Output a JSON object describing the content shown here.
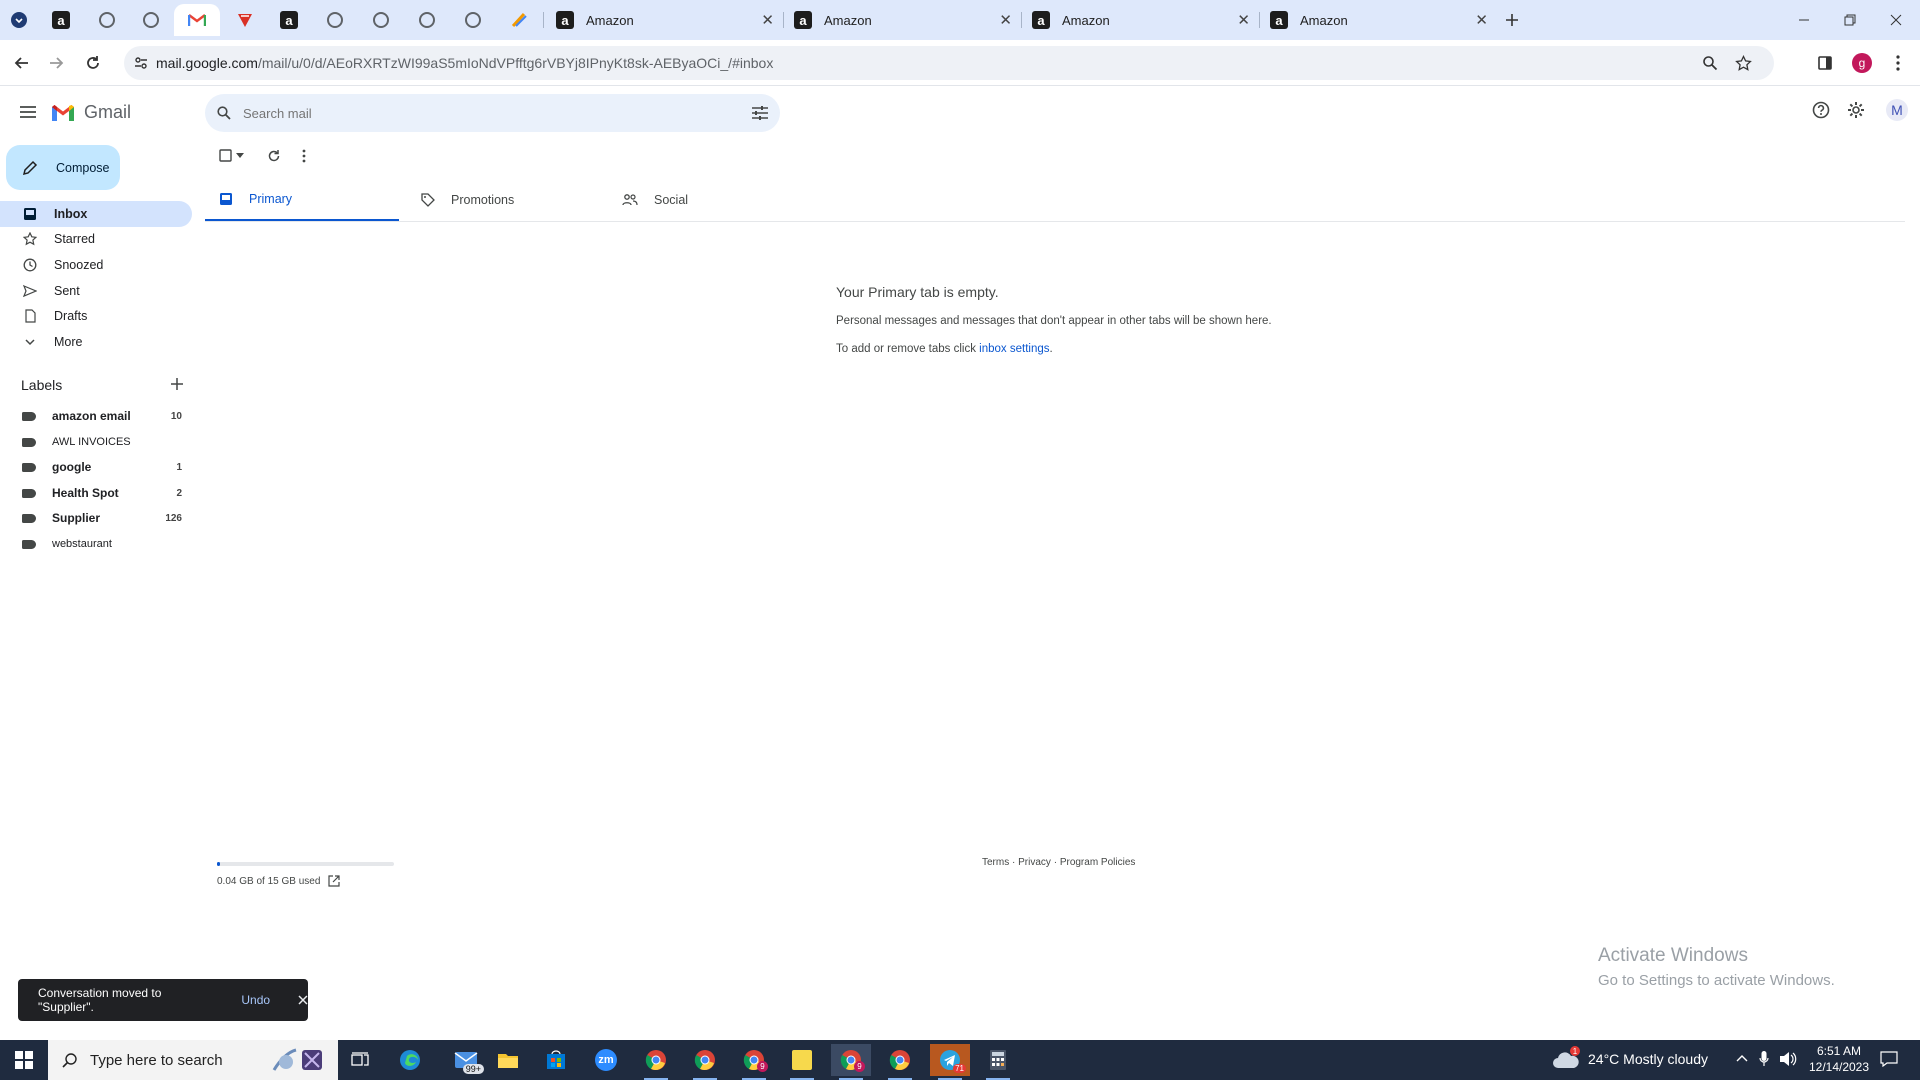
{
  "browser": {
    "tabs": [
      {
        "title": "Amazon"
      },
      {
        "title": "Amazon"
      },
      {
        "title": "Amazon"
      },
      {
        "title": "Amazon"
      }
    ],
    "url_host": "mail.google.com",
    "url_path": "/mail/u/0/d/AEoRXRTzWI99aS5mIoNdVPfftg6rVBYj8IPnyKt8sk-AEByaOCi_/#inbox",
    "profile_initial": "g"
  },
  "gmail": {
    "app_name": "Gmail",
    "search_placeholder": "Search mail",
    "account_initial": "M",
    "compose_label": "Compose",
    "nav": [
      {
        "label": "Inbox"
      },
      {
        "label": "Starred"
      },
      {
        "label": "Snoozed"
      },
      {
        "label": "Sent"
      },
      {
        "label": "Drafts"
      },
      {
        "label": "More"
      }
    ],
    "labels_heading": "Labels",
    "labels": [
      {
        "name": "amazon email",
        "count": "10"
      },
      {
        "name": "AWL INVOICES",
        "count": ""
      },
      {
        "name": "google",
        "count": "1"
      },
      {
        "name": "Health Spot",
        "count": "2"
      },
      {
        "name": "Supplier",
        "count": "126"
      },
      {
        "name": "webstaurant",
        "count": ""
      }
    ],
    "tabs": [
      {
        "label": "Primary"
      },
      {
        "label": "Promotions"
      },
      {
        "label": "Social"
      }
    ],
    "empty": {
      "title": "Your Primary tab is empty.",
      "line1": "Personal messages and messages that don't appear in other tabs will be shown here.",
      "line2_prefix": "To add or remove tabs click ",
      "line2_link": "inbox settings",
      "line2_suffix": "."
    },
    "storage": {
      "text": "0.04 GB of 15 GB used",
      "fraction": 0.003
    },
    "footer": {
      "terms": "Terms",
      "sep": " · ",
      "privacy": "Privacy",
      "policies": "Program Policies"
    },
    "snackbar": {
      "message": "Conversation moved to \"Supplier\".",
      "action": "Undo"
    }
  },
  "watermark": {
    "title": "Activate Windows",
    "subtitle": "Go to Settings to activate Windows."
  },
  "taskbar": {
    "search_placeholder": "Type here to search",
    "mail_badge": "99+",
    "chrome_badge": "9",
    "telegram_badge": "71",
    "weather": "24°C  Mostly cloudy",
    "weather_badge": "1",
    "time": "6:51 AM",
    "date": "12/14/2023"
  }
}
